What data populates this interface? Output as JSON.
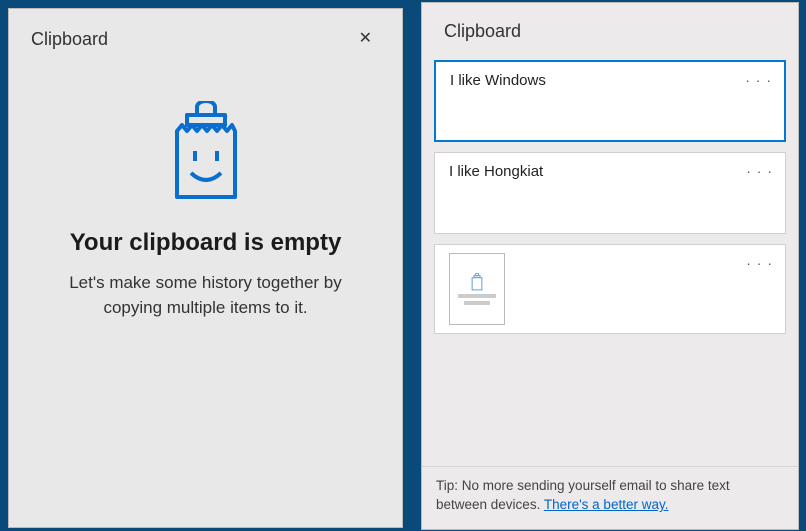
{
  "left": {
    "title": "Clipboard",
    "close_glyph": "✕",
    "emptyHeading": "Your clipboard is empty",
    "emptySub": "Let's make some history together by copying multiple items to it."
  },
  "right": {
    "title": "Clipboard",
    "items": [
      {
        "text": "I like Windows",
        "menu": "· · ·",
        "selected": true,
        "type": "text"
      },
      {
        "text": "I like Hongkiat",
        "menu": "· · ·",
        "selected": false,
        "type": "text"
      },
      {
        "text": "",
        "menu": "· · ·",
        "selected": false,
        "type": "image"
      }
    ],
    "tipPrefix": "Tip: No more sending yourself email to share text between devices.  ",
    "tipLink": "There's a better way."
  },
  "colors": {
    "accent": "#0078d4"
  }
}
